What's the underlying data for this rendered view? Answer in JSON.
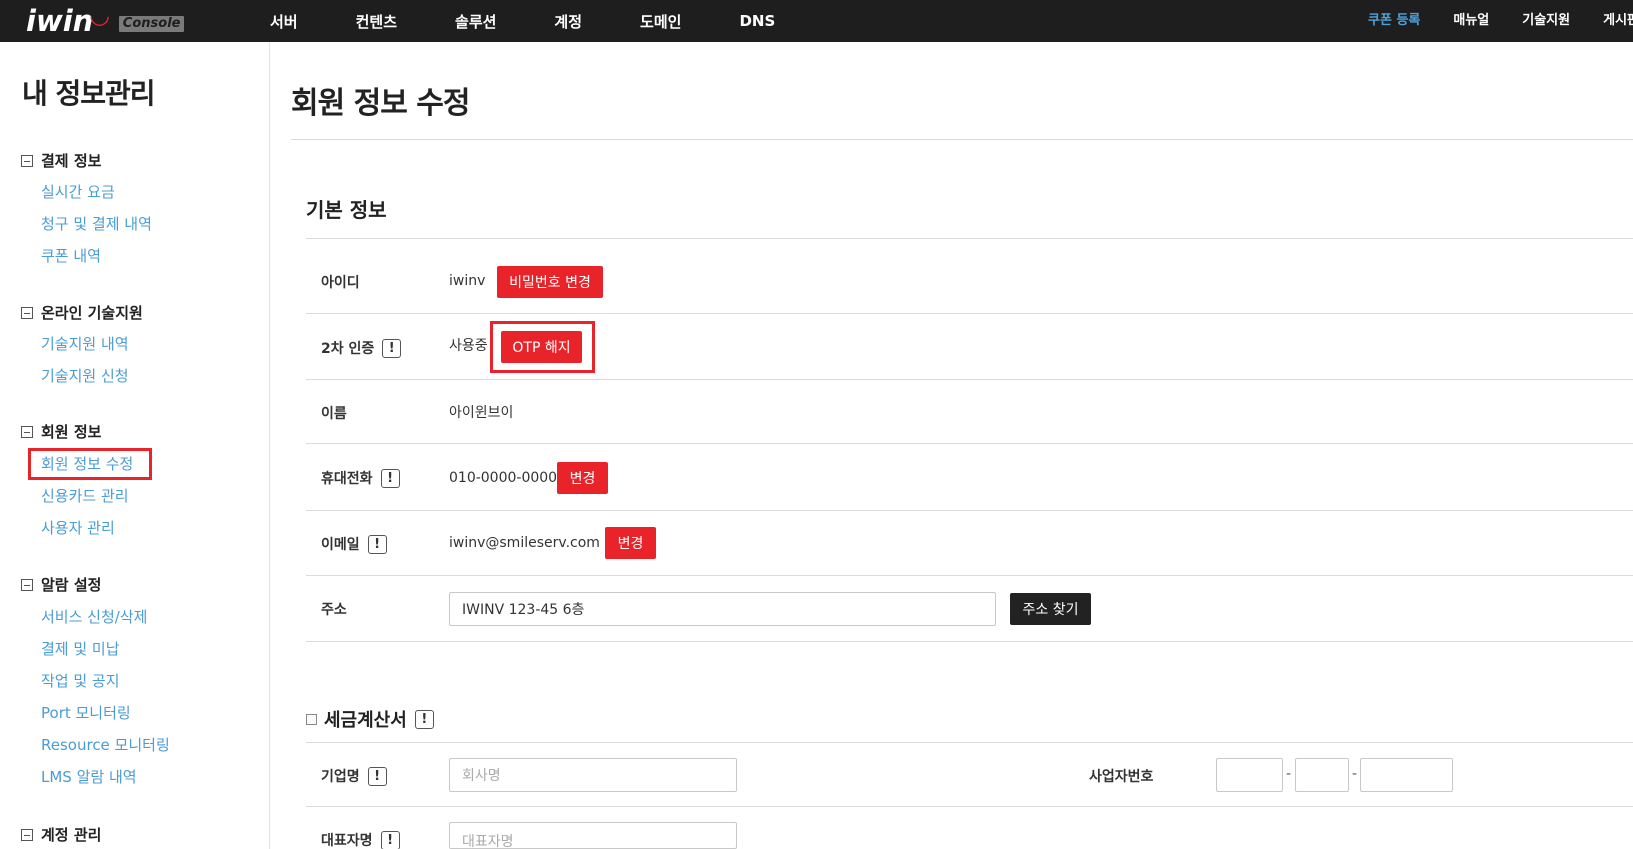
{
  "brand": {
    "name": "iwin",
    "badge": "Console"
  },
  "nav": {
    "main": [
      "서버",
      "컨텐츠",
      "솔루션",
      "계정",
      "도메인",
      "DNS"
    ],
    "coupon": "쿠폰 등록",
    "right": [
      "매뉴얼",
      "기술지원",
      "게시판"
    ]
  },
  "colors": {
    "topbar": "#1e1e1e",
    "link": "#4a9cd6",
    "accent_red": "#e8232a",
    "coupon": "#4da3e0"
  },
  "sidebar": {
    "title": "내 정보관리",
    "sections": [
      {
        "head": "결제 정보",
        "items": [
          "실시간 요금",
          "청구 및 결제 내역",
          "쿠폰 내역"
        ]
      },
      {
        "head": "온라인 기술지원",
        "items": [
          "기술지원 내역",
          "기술지원 신청"
        ]
      },
      {
        "head": "회원 정보",
        "items": [
          "회원 정보 수정",
          "신용카드 관리",
          "사용자 관리"
        ]
      },
      {
        "head": "알람 설정",
        "items": [
          "서비스 신청/삭제",
          "결제 및 미납",
          "작업 및 공지",
          "Port 모니터링",
          "Resource 모니터링",
          "LMS 알람 내역"
        ]
      },
      {
        "head": "계정 관리",
        "items": []
      }
    ],
    "active": "회원 정보 수정"
  },
  "main": {
    "title": "회원 정보 수정",
    "basic_title": "기본 정보",
    "rows": {
      "id": {
        "label": "아이디",
        "value": "iwinv",
        "button": "비밀번호 변경"
      },
      "otp": {
        "label": "2차 인증",
        "value": "사용중",
        "button": "OTP 해지"
      },
      "name": {
        "label": "이름",
        "value": "아이윈브이"
      },
      "phone": {
        "label": "휴대전화",
        "value": "010-0000-0000",
        "button": "변경"
      },
      "email": {
        "label": "이메일",
        "value": "iwinv@smileserv.com",
        "button": "변경"
      },
      "address": {
        "label": "주소",
        "value": "IWINV 123-45 6층",
        "button": "주소 찾기"
      }
    },
    "tax": {
      "title": "세금계산서",
      "company_label": "기업명",
      "company_placeholder": "회사명",
      "bizno_label": "사업자번호",
      "ceo_label": "대표자명",
      "ceo_placeholder": "대표자명"
    },
    "exclamation": "!"
  }
}
